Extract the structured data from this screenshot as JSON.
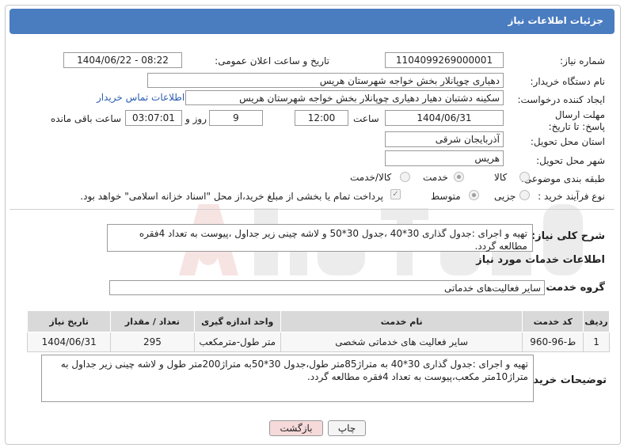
{
  "header": {
    "title": "جزئیات اطلاعات نیاز"
  },
  "form": {
    "need_number_label": "شماره نیاز:",
    "need_number": "1104099269000001",
    "announce_label": "تاریخ و ساعت اعلان عمومی:",
    "announce_value": "1404/06/22 - 08:22",
    "buyer_org_label": "نام دستگاه خریدار:",
    "buyer_org": "دهیاری چوپانلار بخش خواجه شهرستان هریس",
    "creator_label": "ایجاد کننده درخواست:",
    "creator": "سکینه دشتبان دهیار دهیاری چوپانلار بخش خواجه شهرستان هریس",
    "contact_link": "اطلاعات تماس خریدار",
    "deadline_label": "مهلت ارسال پاسخ: تا تاریخ:",
    "deadline_date": "1404/06/31",
    "time_label": "ساعت",
    "deadline_time": "12:00",
    "days_value": "9",
    "days_label": "روز و",
    "remaining_time": "03:07:01",
    "remaining_label": "ساعت باقی مانده",
    "province_label": "استان محل تحویل:",
    "province": "آذربایجان شرقی",
    "city_label": "شهر محل تحویل:",
    "city": "هریس",
    "category_label": "طبقه بندی موضوعی:",
    "category_options": [
      "کالا",
      "خدمت",
      "کالا/خدمت"
    ],
    "process_label": "نوع فرآیند خرید :",
    "process_options": [
      "جزیی",
      "متوسط"
    ],
    "payment_note": "پرداخت تمام یا بخشی از مبلغ خرید،از محل \"اسناد خزانه اسلامی\" خواهد بود."
  },
  "summary": {
    "label": "شرح کلی نیاز:",
    "text": "تهیه و اجرای :جدول گذاری 30*40 ،جدول 30*50 و لاشه چینی زیر جداول ،پیوست به تعداد 4فقره مطالعه گردد."
  },
  "services": {
    "section_title": "اطلاعات خدمات مورد نیاز",
    "group_label": "گروه خدمت:",
    "group_value": "سایر فعالیت‌های خدماتی",
    "columns": [
      "ردیف",
      "کد خدمت",
      "نام خدمت",
      "واحد اندازه گیری",
      "تعداد / مقدار",
      "تاریخ نیاز"
    ],
    "rows": [
      [
        "1",
        "ط-96-960",
        "سایر فعالیت های خدماتی شخصی",
        "متر طول-مترمکعب",
        "295",
        "1404/06/31"
      ]
    ]
  },
  "buyer_notes": {
    "label": "توضیحات خریدار:",
    "text": "تهیه و اجرای :جدول گذاری 30*40 به متراژ85متر طول،جدول 30*50به متراژ200متر طول و لاشه چینی زیر جداول به متراژ10متر مکعب،پیوست به تعداد 4فقره مطالعه گردد."
  },
  "buttons": {
    "print": "چاپ",
    "back": "بازگشت"
  },
  "colors": {
    "title_bar": "#4a7cc0",
    "back_button": "#f6d9d9"
  }
}
